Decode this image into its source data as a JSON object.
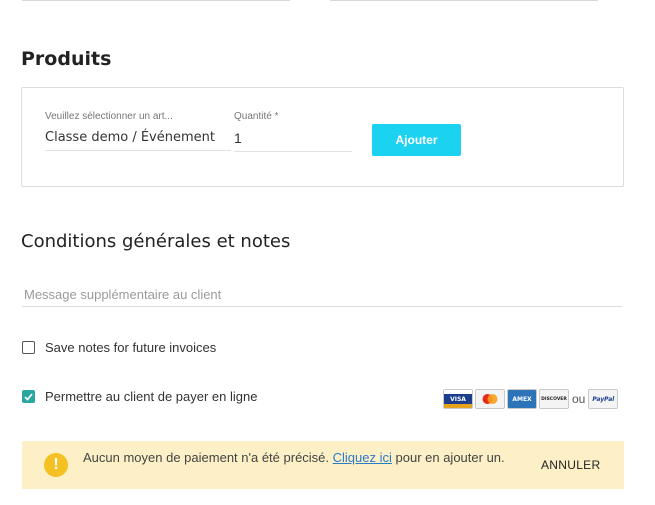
{
  "products": {
    "title": "Produits",
    "article_label": "Veuillez sélectionner un art...",
    "article_value": "Classe demo / Événement",
    "quantity_label": "Quantité *",
    "quantity_value": "1",
    "add_label": "Ajouter"
  },
  "conditions": {
    "title": "Conditions générales et notes",
    "message_placeholder": "Message supplémentaire au client",
    "save_notes_label": "Save notes for future invoices",
    "save_notes_checked": false,
    "pay_online_label": "Permettre au client de payer en ligne",
    "pay_online_checked": true
  },
  "payment_methods": {
    "visa": "VISA",
    "mastercard_icon": "mastercard-icon",
    "amex": "AMEX",
    "discover": "DISCOVER",
    "separator": "ou",
    "paypal": "PayPal"
  },
  "alert": {
    "icon": "warning-icon",
    "text_before": "Aucun moyen de paiement n'a été précisé. ",
    "link_text": "Cliquez ici",
    "text_after": " pour en ajouter un.",
    "cancel_label": "ANNULER"
  },
  "colors": {
    "accent": "#1cd2f1",
    "checkbox_checked": "#2aa7a0",
    "alert_background": "#fdf0c6",
    "alert_icon": "#f5c122",
    "link": "#2a7ac8"
  }
}
